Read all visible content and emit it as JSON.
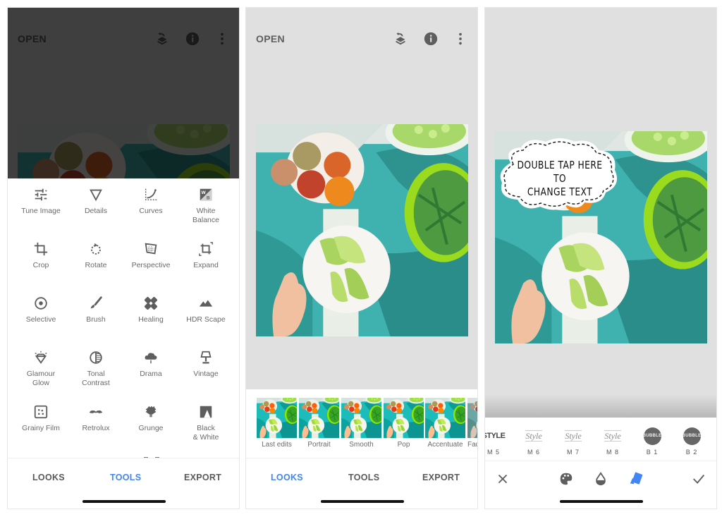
{
  "screens": [
    {
      "name": "tools",
      "header": {
        "open_label": "OPEN",
        "icons": [
          "undo-layers-icon",
          "info-icon",
          "more-vert-icon"
        ]
      },
      "tools": [
        {
          "label": "Tune Image",
          "icon": "tune-sliders-icon"
        },
        {
          "label": "Details",
          "icon": "details-triangle-icon"
        },
        {
          "label": "Curves",
          "icon": "curves-icon"
        },
        {
          "label": "White\nBalance",
          "icon": "white-balance-icon"
        },
        {
          "label": "Crop",
          "icon": "crop-icon"
        },
        {
          "label": "Rotate",
          "icon": "rotate-icon"
        },
        {
          "label": "Perspective",
          "icon": "perspective-icon"
        },
        {
          "label": "Expand",
          "icon": "expand-icon"
        },
        {
          "label": "Selective",
          "icon": "selective-icon"
        },
        {
          "label": "Brush",
          "icon": "brush-icon"
        },
        {
          "label": "Healing",
          "icon": "healing-bandage-icon"
        },
        {
          "label": "HDR Scape",
          "icon": "mountains-icon"
        },
        {
          "label": "Glamour\nGlow",
          "icon": "diamond-glow-icon"
        },
        {
          "label": "Tonal\nContrast",
          "icon": "tonal-contrast-icon"
        },
        {
          "label": "Drama",
          "icon": "storm-cloud-icon"
        },
        {
          "label": "Vintage",
          "icon": "lamp-icon"
        },
        {
          "label": "Grainy Film",
          "icon": "grain-icon"
        },
        {
          "label": "Retrolux",
          "icon": "mustache-icon"
        },
        {
          "label": "Grunge",
          "icon": "grunge-icon"
        },
        {
          "label": "Black\n& White",
          "icon": "black-white-icon"
        }
      ],
      "nav": {
        "tabs": [
          "LOOKS",
          "TOOLS",
          "EXPORT"
        ],
        "active": "TOOLS"
      }
    },
    {
      "name": "looks",
      "header": {
        "open_label": "OPEN"
      },
      "looks": [
        "Last edits",
        "Portrait",
        "Smooth",
        "Pop",
        "Accentuate",
        "Faded"
      ],
      "nav": {
        "tabs": [
          "LOOKS",
          "TOOLS",
          "EXPORT"
        ],
        "active": "LOOKS"
      }
    },
    {
      "name": "text",
      "sticker_text": "Double tap here to\nchange text",
      "styles": [
        {
          "label": "M 5",
          "preview": "STYLE"
        },
        {
          "label": "M 6",
          "preview": "Style"
        },
        {
          "label": "M 7",
          "preview": "Style"
        },
        {
          "label": "M 8",
          "preview": "Style"
        },
        {
          "label": "B 1",
          "preview": "BUBBLE"
        },
        {
          "label": "B 2",
          "preview": "BUBBLE"
        }
      ],
      "actions": [
        "close-icon",
        "palette-icon",
        "opacity-drop-icon",
        "style-cards-icon",
        "check-icon"
      ],
      "active_action": "style-cards-icon"
    }
  ],
  "colors": {
    "accent": "#4285f4",
    "canvas_bg": "#e0e0e0",
    "icon_gray": "#5e5e5e",
    "label_gray": "#6a6a6a"
  }
}
